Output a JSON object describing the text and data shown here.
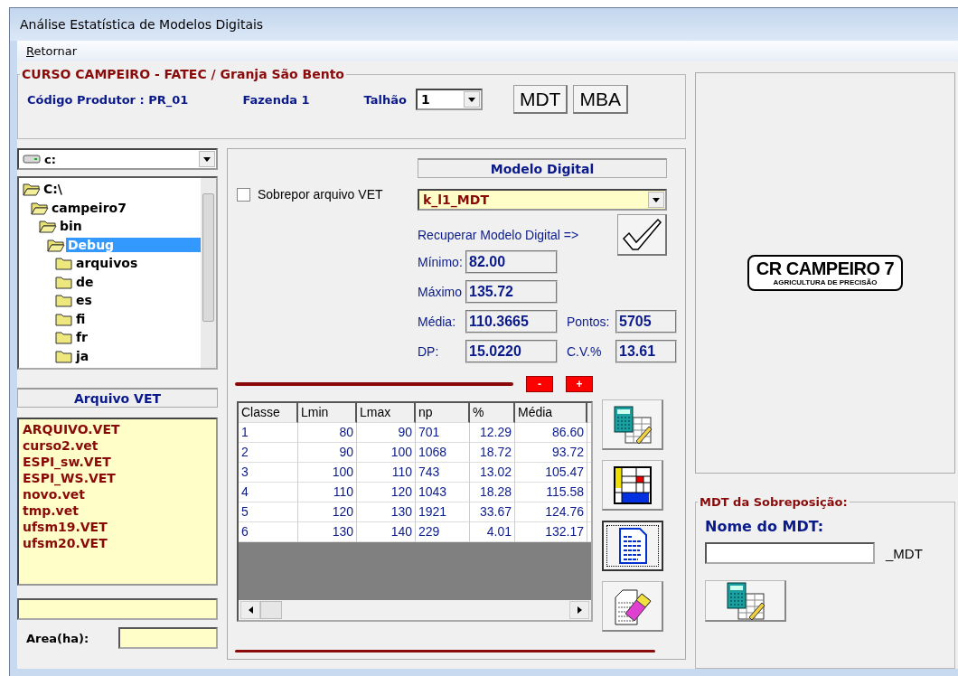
{
  "window": {
    "title": "Análise  Estatística de Modelos Digitais"
  },
  "menu": [
    {
      "label": "Retornar"
    }
  ],
  "header": {
    "title": "CURSO CAMPEIRO - FATEC / Granja São Bento",
    "producer": "Código Produtor :  PR_01",
    "farm": "Fazenda 1",
    "plot_label": "Talhão",
    "plot_value": "1",
    "buttons": [
      "MDT",
      "MBA"
    ]
  },
  "drive_select": {
    "value": "c:"
  },
  "folder_tree": [
    {
      "label": "C:\\",
      "expanded": true,
      "selected": false,
      "children": [
        {
          "label": "campeiro7",
          "expanded": true,
          "selected": false,
          "children": [
            {
              "label": "bin",
              "expanded": true,
              "selected": false,
              "children": [
                {
                  "label": "Debug",
                  "expanded": true,
                  "selected": true,
                  "children": [
                    {
                      "label": "arquivos",
                      "expanded": false,
                      "selected": false
                    },
                    {
                      "label": "de",
                      "expanded": false,
                      "selected": false
                    },
                    {
                      "label": "es",
                      "expanded": false,
                      "selected": false
                    },
                    {
                      "label": "fi",
                      "expanded": false,
                      "selected": false
                    },
                    {
                      "label": "fr",
                      "expanded": false,
                      "selected": false
                    },
                    {
                      "label": "ja",
                      "expanded": false,
                      "selected": false
                    }
                  ]
                }
              ]
            }
          ]
        }
      ]
    }
  ],
  "vet_panel": {
    "title": "Arquivo VET",
    "files": [
      "ARQUIVO.VET",
      "curso2.vet",
      "ESPI_sw.VET",
      "ESPI_WS.VET",
      "novo.vet",
      "tmp.vet",
      "ufsm19.VET",
      "ufsm20.VET"
    ],
    "area_label": "Area(ha):"
  },
  "overlay_checkbox": {
    "label": "Sobrepor arquivo VET",
    "checked": false
  },
  "model": {
    "title": "Modelo Digital",
    "value": "k_l1_MDT",
    "recover_label": "Recuperar Modelo Digital =>"
  },
  "stats": [
    {
      "label": "Mínimo:",
      "value": "82.00"
    },
    {
      "label": "Máximo",
      "value": "135.72"
    },
    {
      "label": "Média:",
      "value": "110.3665"
    },
    {
      "label": "DP:",
      "value": "15.0220"
    }
  ],
  "stats_side": [
    {
      "label": "Pontos:",
      "value": "5705"
    },
    {
      "label": "C.V.%",
      "value": "13.61"
    }
  ],
  "step_buttons": [
    "-",
    "+"
  ],
  "table": {
    "columns": [
      "Classe",
      "Lmin",
      "Lmax",
      "np",
      "%",
      "Média"
    ],
    "rows": [
      {
        "cells": [
          "1",
          "80",
          "90",
          "701",
          "12.29",
          "86.60"
        ]
      },
      {
        "cells": [
          "2",
          "90",
          "100",
          "1068",
          "18.72",
          "93.72"
        ]
      },
      {
        "cells": [
          "3",
          "100",
          "110",
          "743",
          "13.02",
          "105.47"
        ]
      },
      {
        "cells": [
          "4",
          "110",
          "120",
          "1043",
          "18.28",
          "115.58"
        ]
      },
      {
        "cells": [
          "5",
          "120",
          "130",
          "1921",
          "33.67",
          "124.76"
        ]
      },
      {
        "cells": [
          "6",
          "130",
          "140",
          "229",
          "4.01",
          "132.17"
        ]
      }
    ]
  },
  "tool_buttons": [
    {
      "kind": "calc",
      "focused": false
    },
    {
      "kind": "grid",
      "focused": false
    },
    {
      "kind": "report",
      "focused": true
    },
    {
      "kind": "erase",
      "focused": false
    }
  ],
  "logo": {
    "title": "CR CAMPEIRO 7",
    "subtitle": "AGRICULTURA DE PRECISÃO"
  },
  "overlay_group": {
    "title": "MDT da Sobreposição:",
    "name_label": "Nome do MDT:",
    "suffix": "_MDT"
  }
}
